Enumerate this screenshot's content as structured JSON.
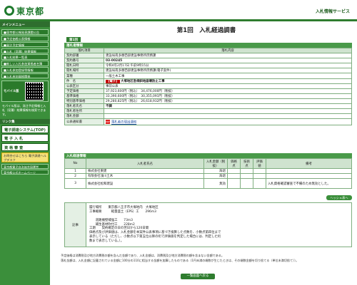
{
  "header": {
    "logo": "東京都",
    "service": "入札情報サービス"
  },
  "sidebar": {
    "menu_title": "メインメニュー",
    "menu": [
      "■東京都公報発表課題公告",
      "■予定価格公表情報",
      "■発注予定情報",
      "■入札（見積）結果情報",
      "■入札結果一覧表",
      "■新しい入札参加資格者名簿",
      "■入札参加登録等情報",
      "■入札参加資格関係"
    ],
    "mobile_label": "モバイル版",
    "mobile_note": "モバイル版は、発注予定情報と入札（見積）結果情報を検索できます。",
    "links_title": "リンク集",
    "big_buttons": [
      "電子調達システム(TOP)",
      "電 子 入 札",
      "資 格 審 査"
    ],
    "help_text": "お問合せはこちら 電子調達ヘルプデスク",
    "footer_links": [
      "東京都電子自治体共同運営",
      "東京都公式ホームページ"
    ]
  },
  "main": {
    "page_title": "第1回　入札経過調書",
    "round_tab": "第1回",
    "section1_title": "落札者情報",
    "columns": {
      "item": "落札項目",
      "content": "落札内容"
    },
    "rows": [
      {
        "label": "契約部署",
        "value": "建設局南多摩西部建設事務所庶務課"
      },
      {
        "label": "契約番号",
        "value": "03-00245"
      },
      {
        "label": "開札日時",
        "value": "令和4年2月17日 午前9時15分"
      },
      {
        "label": "開札場所",
        "value": "建設局南多摩西部建設事務所庶務課(電子案件)"
      },
      {
        "label": "業種",
        "value": "一般土木工事"
      },
      {
        "label": "件　名",
        "tag": "【電子】",
        "value": "大塚地区急傾斜地崩壊防止工事"
      },
      {
        "label": "公表区分",
        "value": "事前公表"
      },
      {
        "label": "予定価格",
        "value": "37,923,600円（税込）　34,476,000円（税抜）"
      },
      {
        "label": "基準価格",
        "value": "33,390,600円（税込）　30,355,091円（税抜）"
      },
      {
        "label": "特別基準価格",
        "value": "29,280,825円（税込）　26,618,932円（税抜）"
      },
      {
        "label": "落札者氏名",
        "value": "不調"
      },
      {
        "label": "落札者住所",
        "value": ""
      },
      {
        "label": "落札金額",
        "value": ""
      }
    ],
    "notice_label": "公表通知書",
    "notice_link": "落札者の現出通知",
    "section2_title": "入札経過情報",
    "bid_columns": [
      "No",
      "入札者氏名",
      "入札金額（税抜）",
      "価格点",
      "技術点",
      "評価値",
      "備考"
    ],
    "bids": [
      {
        "no": "1",
        "name": "株式会社東建",
        "amount": "辞退",
        "price": "",
        "tech": "",
        "eval": "",
        "remark": ""
      },
      {
        "no": "2",
        "name": "有限会社浅川土木",
        "amount": "辞退",
        "price": "",
        "tech": "",
        "eval": "",
        "remark": ""
      },
      {
        "no": "3",
        "name": "株式会社松和建設",
        "amount": "無効",
        "price": "",
        "tech": "",
        "eval": "",
        "remark": "入札資格確認審査で不備のため無効とした。"
      }
    ],
    "history_button": "ヘッシュ表へ",
    "remarks_label": "記事",
    "remarks": [
      "履行場所　　東京都八王子市大塚地内　大塚地区",
      "工事概要　　　軽量盛土（EPS）工　　296m3",
      "",
      "　　道路擁壁補強工　　73m3",
      "　　補生基材吹付工　　228m2",
      "工期　　契約確定の日の翌日から120日間",
      "価格点及び評価値は、入札金額を本案件公表事項に基づき換算した点数を、小数点第四位まで",
      "表示している（ただし、小数点以下第五位以降の桁で評価値を判定した場合には、判定した桁",
      "数まで表示している。）。"
    ]
  },
  "notes": [
    "予定価格は消費税及び地方消費税の額を含んだ金額であり、入札金額は、消費税及び地方消費税の額を含まない金額である。",
    "落札金額は、入札金額に記載されている金額に100分の110に相当する金額を加算したものである（1円未満の端数が生じたときは、その端数金額を切り捨てる（単位未満切捨て））。"
  ],
  "back_button": "一覧画面へ戻る"
}
